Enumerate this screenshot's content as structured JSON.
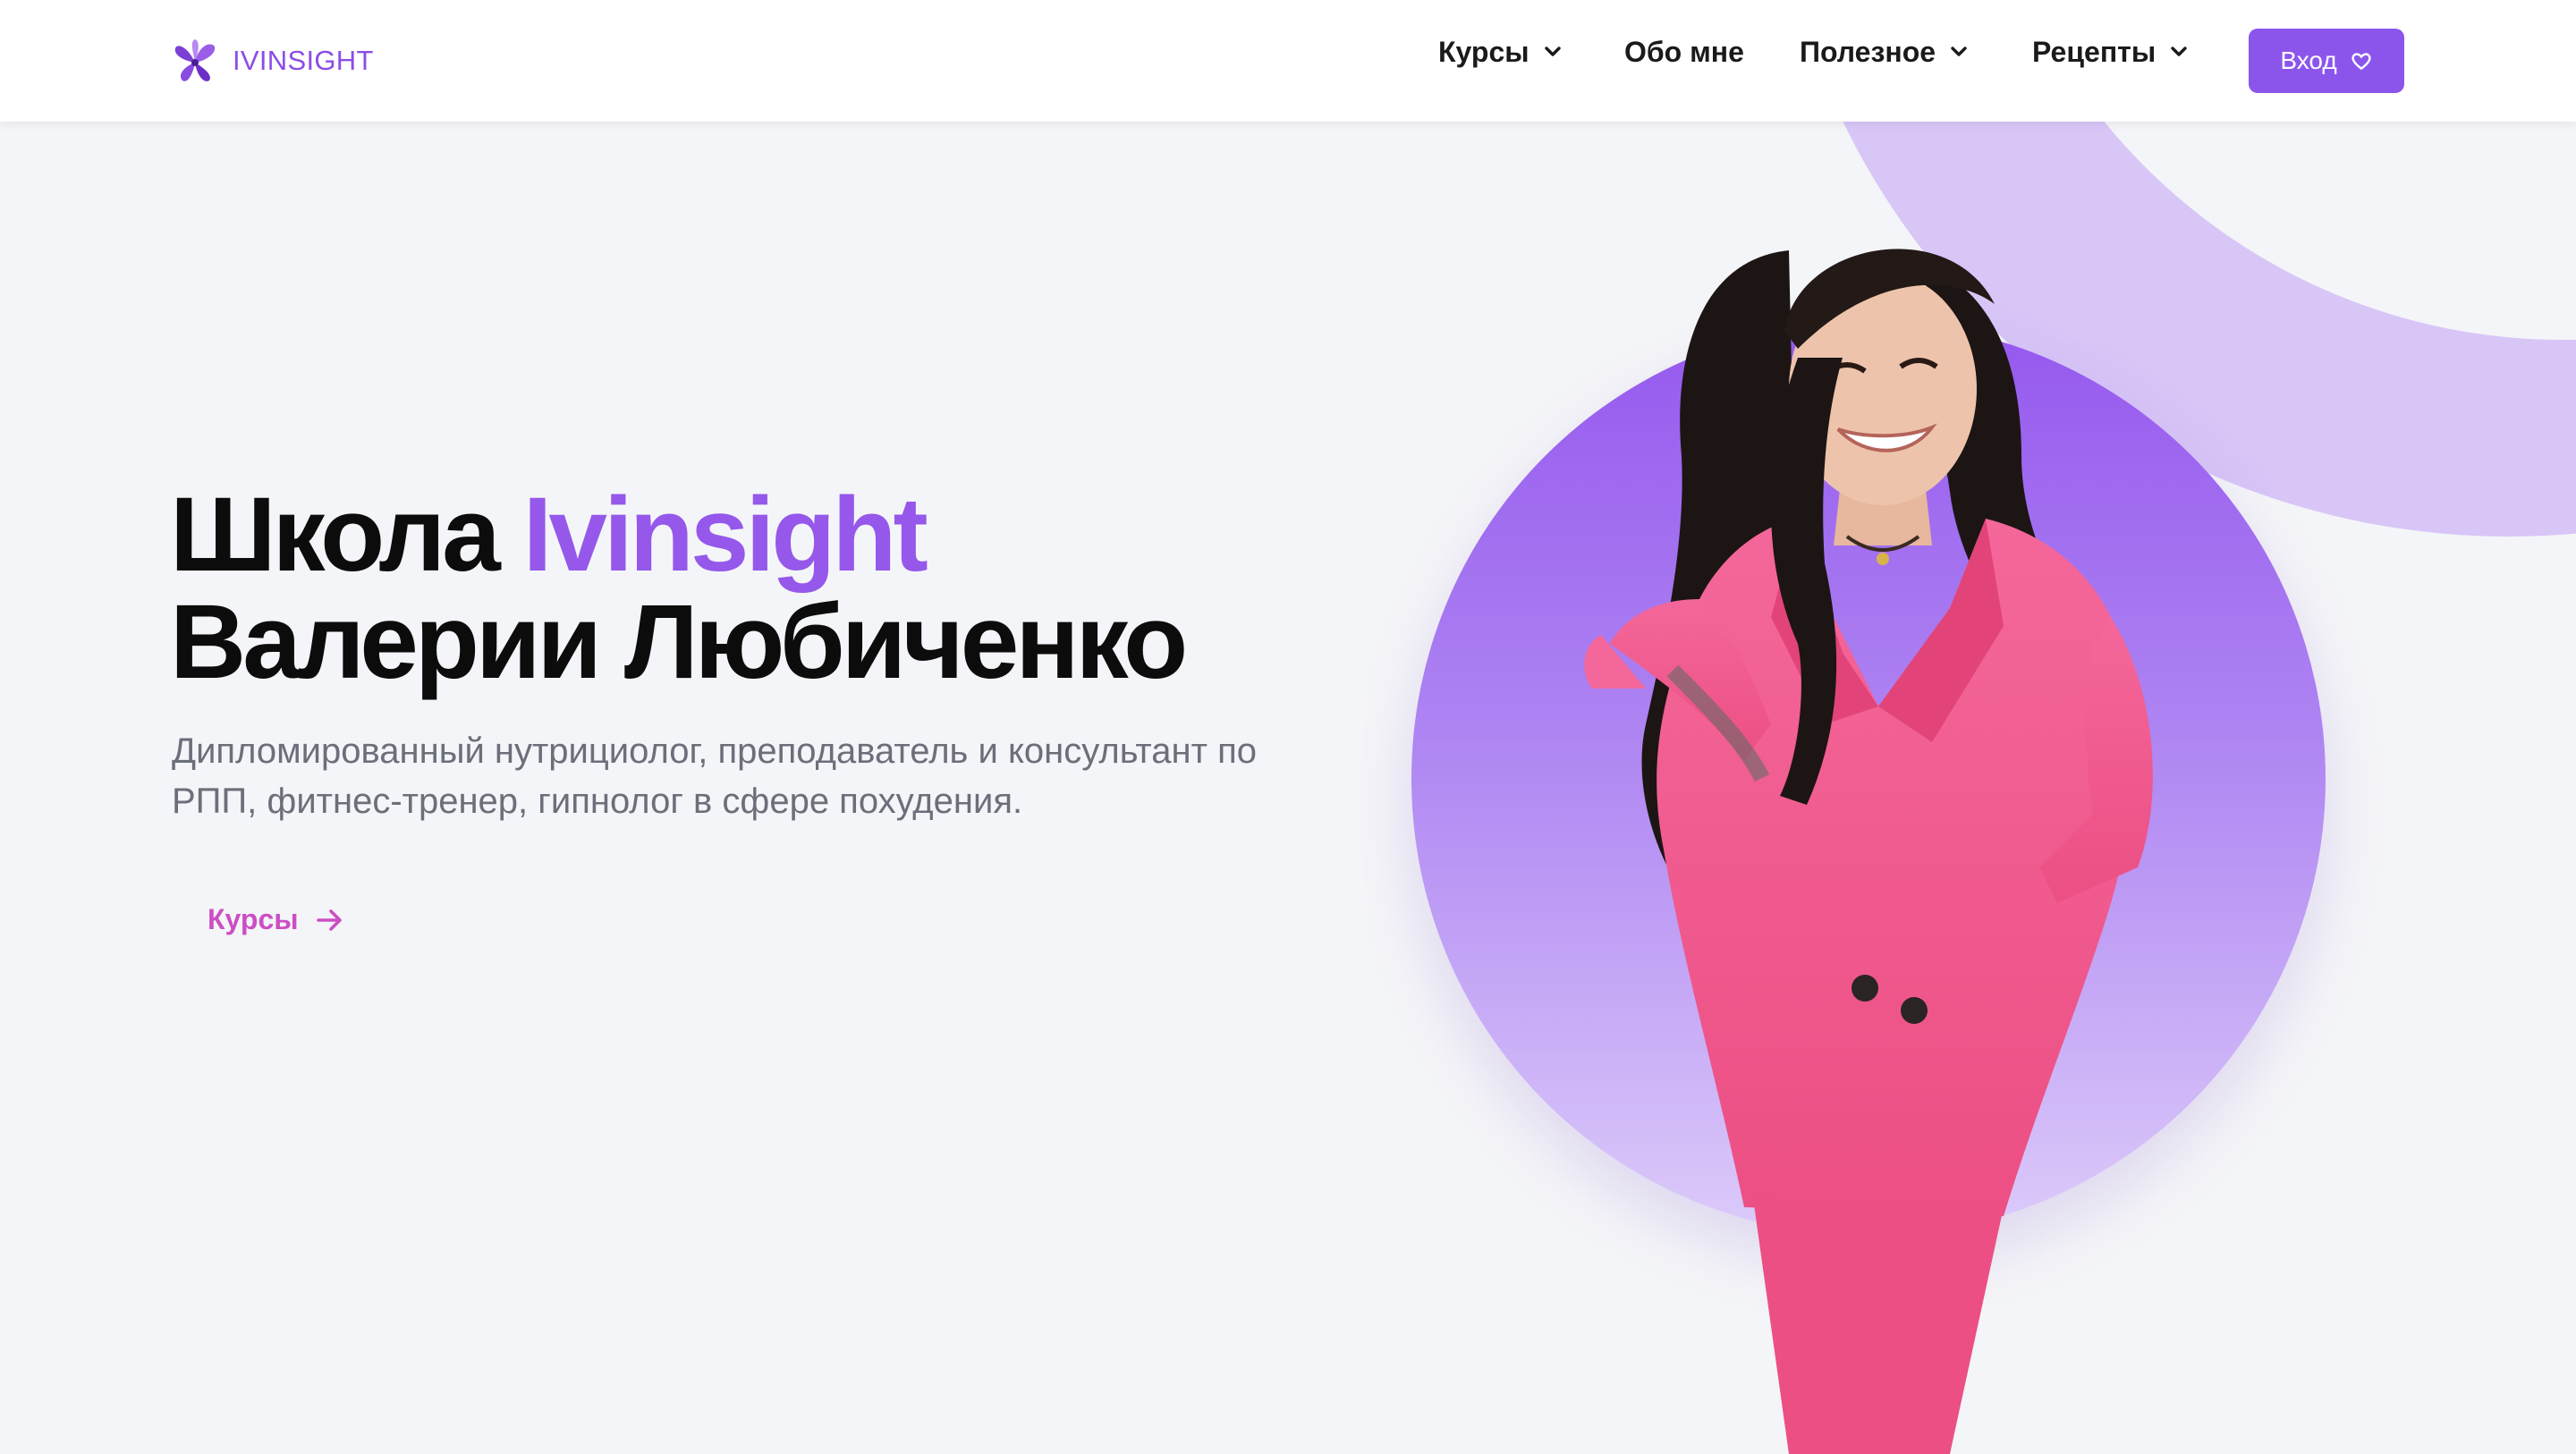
{
  "header": {
    "logo_text": "IVINSIGHT",
    "nav": [
      {
        "label": "Курсы",
        "has_dropdown": true
      },
      {
        "label": "Обо мне",
        "has_dropdown": false
      },
      {
        "label": "Полезное",
        "has_dropdown": true
      },
      {
        "label": "Рецепты",
        "has_dropdown": true
      }
    ],
    "login_label": "Вход",
    "login_icon": "heart-icon"
  },
  "hero": {
    "title_part1": "Школа",
    "title_accent": "Ivinsight",
    "title_line2": "Валерии Любиченко",
    "subtitle": "Дипломированный нутрициолог, преподаватель и консультант по РПП, фитнес-тренер, гипнолог в сфере похудения.",
    "cta_label": "Курсы",
    "cta_icon": "arrow-right-icon"
  },
  "colors": {
    "accent": "#9558ea",
    "button": "#8b55ec",
    "cta": "#cc4fc4",
    "background": "#f4f5f8",
    "suit": "#f05a8c"
  }
}
